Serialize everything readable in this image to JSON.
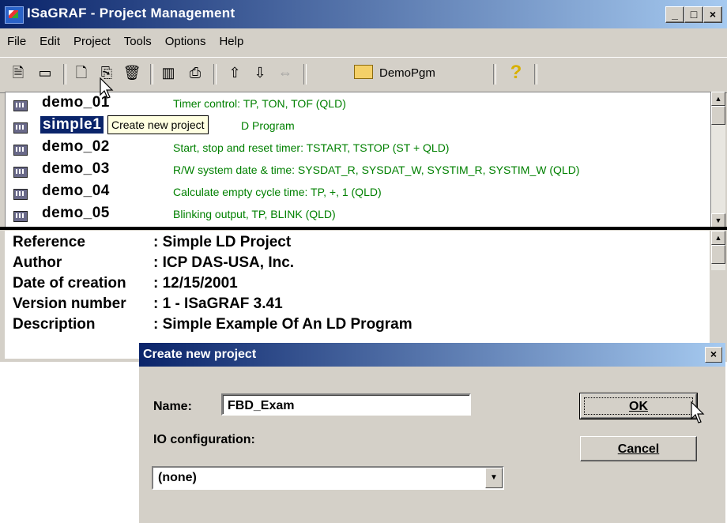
{
  "window": {
    "title": "ISaGRAF - Project Management",
    "min": "_",
    "max": "□",
    "close": "×"
  },
  "menu": [
    "File",
    "Edit",
    "Project",
    "Tools",
    "Options",
    "Help"
  ],
  "toolbar": {
    "demo_label": "DemoPgm",
    "help_glyph": "?"
  },
  "tooltip": "Create new project",
  "projects": [
    {
      "name": "demo_01",
      "shown_name": "demo_01",
      "desc": "Timer control:  TP, TON, TOF  (QLD)"
    },
    {
      "name": "simple1",
      "shown_name": "simple1",
      "desc": "D Program",
      "selected": true
    },
    {
      "name": "demo_02",
      "shown_name": "demo_02",
      "desc": "Start, stop and reset timer:  TSTART, TSTOP  (ST + QLD)"
    },
    {
      "name": "demo_03",
      "shown_name": "demo_03",
      "desc": "R/W system date & time:  SYSDAT_R, SYSDAT_W, SYSTIM_R, SYSTIM_W  (QLD)"
    },
    {
      "name": "demo_04",
      "shown_name": "demo_04",
      "desc": "Calculate empty cycle time:  TP, +, 1  (QLD)"
    },
    {
      "name": "demo_05",
      "shown_name": "demo_05",
      "desc": "Blinking output,  TP, BLINK  (QLD)"
    }
  ],
  "info": [
    {
      "label": "Reference",
      "value": ": Simple LD Project"
    },
    {
      "label": "Author",
      "value": ": ICP DAS-USA, Inc."
    },
    {
      "label": "Date of creation",
      "value": ": 12/15/2001"
    },
    {
      "label": "Version number",
      "value": ": 1 - ISaGRAF 3.41"
    },
    {
      "label": "Description",
      "value": ": Simple Example Of An LD Program"
    }
  ],
  "dialog": {
    "title": "Create new project",
    "name_label": "Name:",
    "name_value": "FBD_Exam",
    "io_label": "IO configuration:",
    "io_value": "(none)",
    "ok": "OK",
    "cancel": "Cancel",
    "close": "×"
  }
}
